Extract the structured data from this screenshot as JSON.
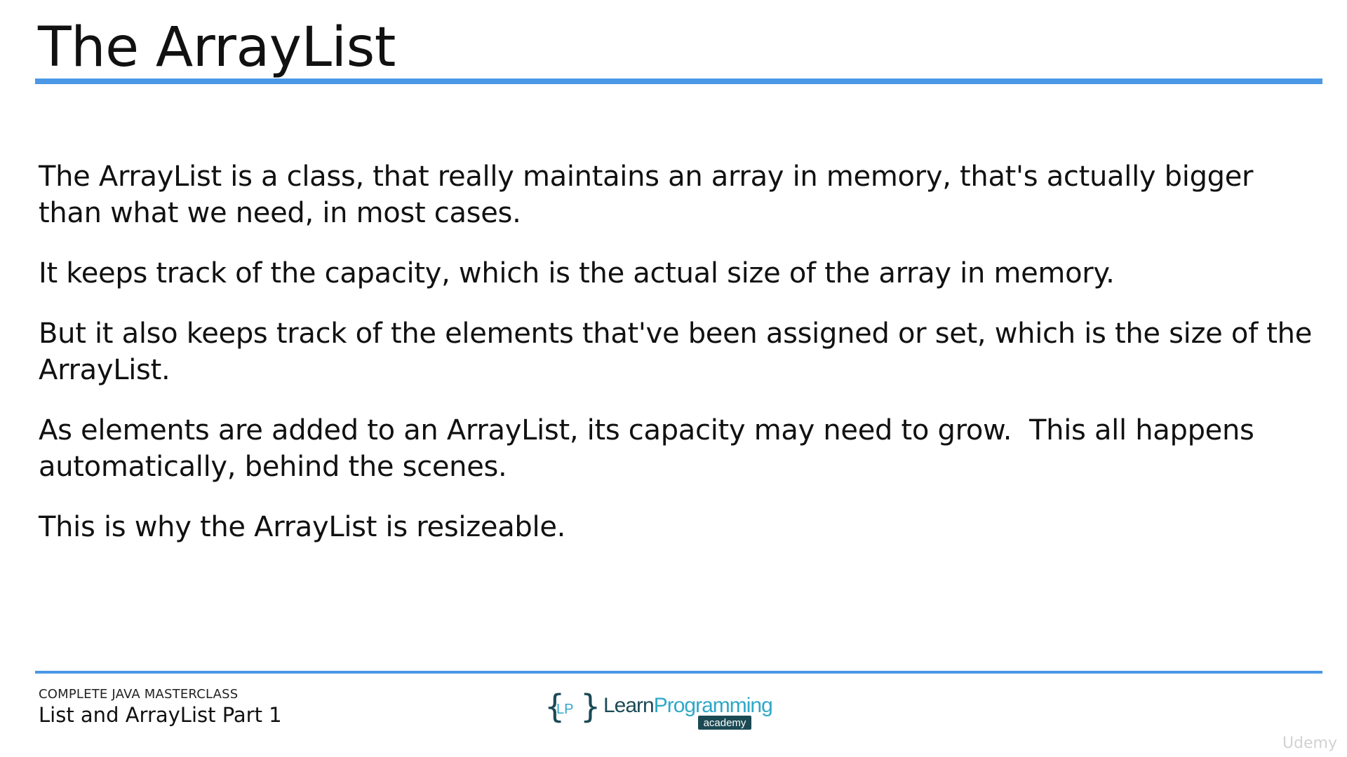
{
  "slide": {
    "title": "The ArrayList",
    "paragraphs": [
      "The ArrayList is a class, that really maintains an array in memory, that's actually bigger than what we need, in most cases.",
      "It keeps track of the capacity, which is the actual size of the array in memory.",
      "But it also keeps track of the elements that've been assigned or set, which is the size of the ArrayList.",
      "As elements are added to an ArrayList, its capacity may need to grow.  This all happens automatically, behind the scenes.",
      "This is why the ArrayList is resizeable."
    ]
  },
  "footer": {
    "course": "COMPLETE JAVA MASTERCLASS",
    "lecture": "List and ArrayList Part 1",
    "logo": {
      "badge": "LP",
      "name_part1": "Learn",
      "name_part2": "Programming",
      "tag": "academy"
    },
    "watermark": "Udemy"
  },
  "colors": {
    "accent_rule": "#4a98e6",
    "logo_dark": "#1b4a55",
    "logo_teal": "#2fa8c8"
  },
  "icons": [
    "logo-brackets-icon"
  ]
}
